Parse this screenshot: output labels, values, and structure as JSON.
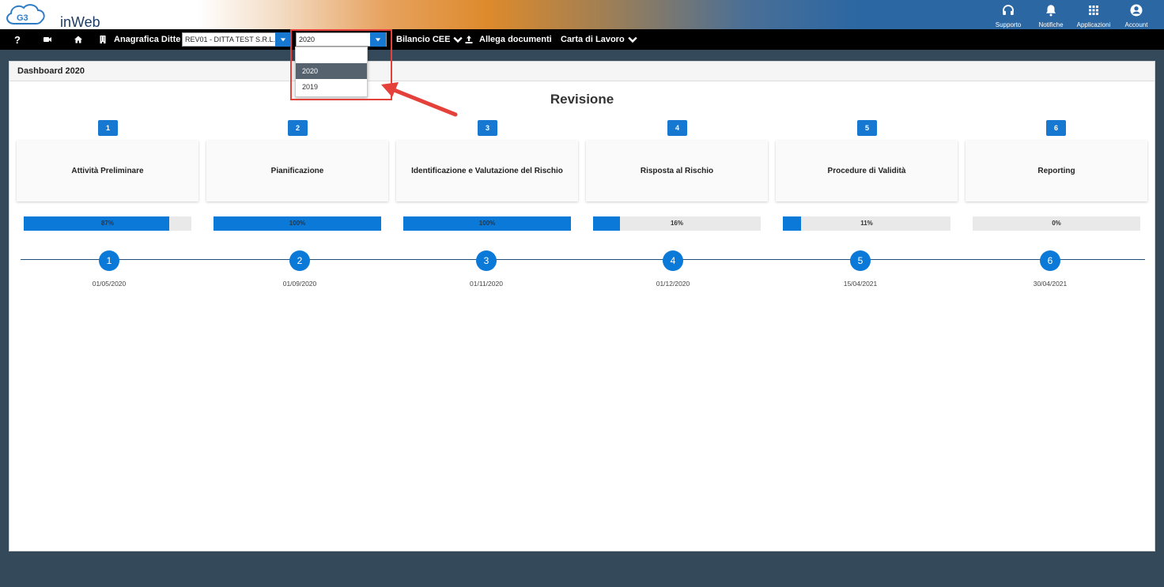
{
  "header": {
    "logo_text": "inWeb",
    "logo_badge": "G3",
    "actions": [
      {
        "label": "Supporto",
        "icon": "headset-icon"
      },
      {
        "label": "Notifiche",
        "icon": "bell-icon"
      },
      {
        "label": "Applicazioni",
        "icon": "grid-icon"
      },
      {
        "label": "Account",
        "icon": "user-circle-icon"
      }
    ],
    "bg_color": "#2a67a3"
  },
  "navbar": {
    "help_label": "?",
    "anagrafica_label": "Anagrafica Ditte",
    "company_value": "REV01 - DITTA TEST S.R.L.",
    "year_value": "2020",
    "bilancio_label": "Bilancio CEE",
    "allega_label": "Allega documenti",
    "carta_label": "Carta di Lavoro"
  },
  "year_dropdown": {
    "open": true,
    "options": [
      "",
      "2020",
      "2019"
    ],
    "selected": "2020"
  },
  "panel": {
    "header": "Dashboard 2020",
    "title": "Revisione"
  },
  "steps": [
    {
      "num": "1",
      "label": "Attività Preliminare",
      "progress": 87,
      "progress_label": "87%",
      "date": "01/05/2020"
    },
    {
      "num": "2",
      "label": "Pianificazione",
      "progress": 100,
      "progress_label": "100%",
      "date": "01/09/2020"
    },
    {
      "num": "3",
      "label": "Identificazione e Valutazione del Rischio",
      "progress": 100,
      "progress_label": "100%",
      "date": "01/11/2020"
    },
    {
      "num": "4",
      "label": "Risposta al Rischio",
      "progress": 16,
      "progress_label": "16%",
      "date": "01/12/2020"
    },
    {
      "num": "5",
      "label": "Procedure di Validità",
      "progress": 11,
      "progress_label": "11%",
      "date": "15/04/2021"
    },
    {
      "num": "6",
      "label": "Reporting",
      "progress": 0,
      "progress_label": "0%",
      "date": "30/04/2021"
    }
  ],
  "colors": {
    "accent": "#1778d2",
    "progress_fill": "#0b79d8",
    "highlight": "#e5413b",
    "page_bg": "#34495a"
  }
}
